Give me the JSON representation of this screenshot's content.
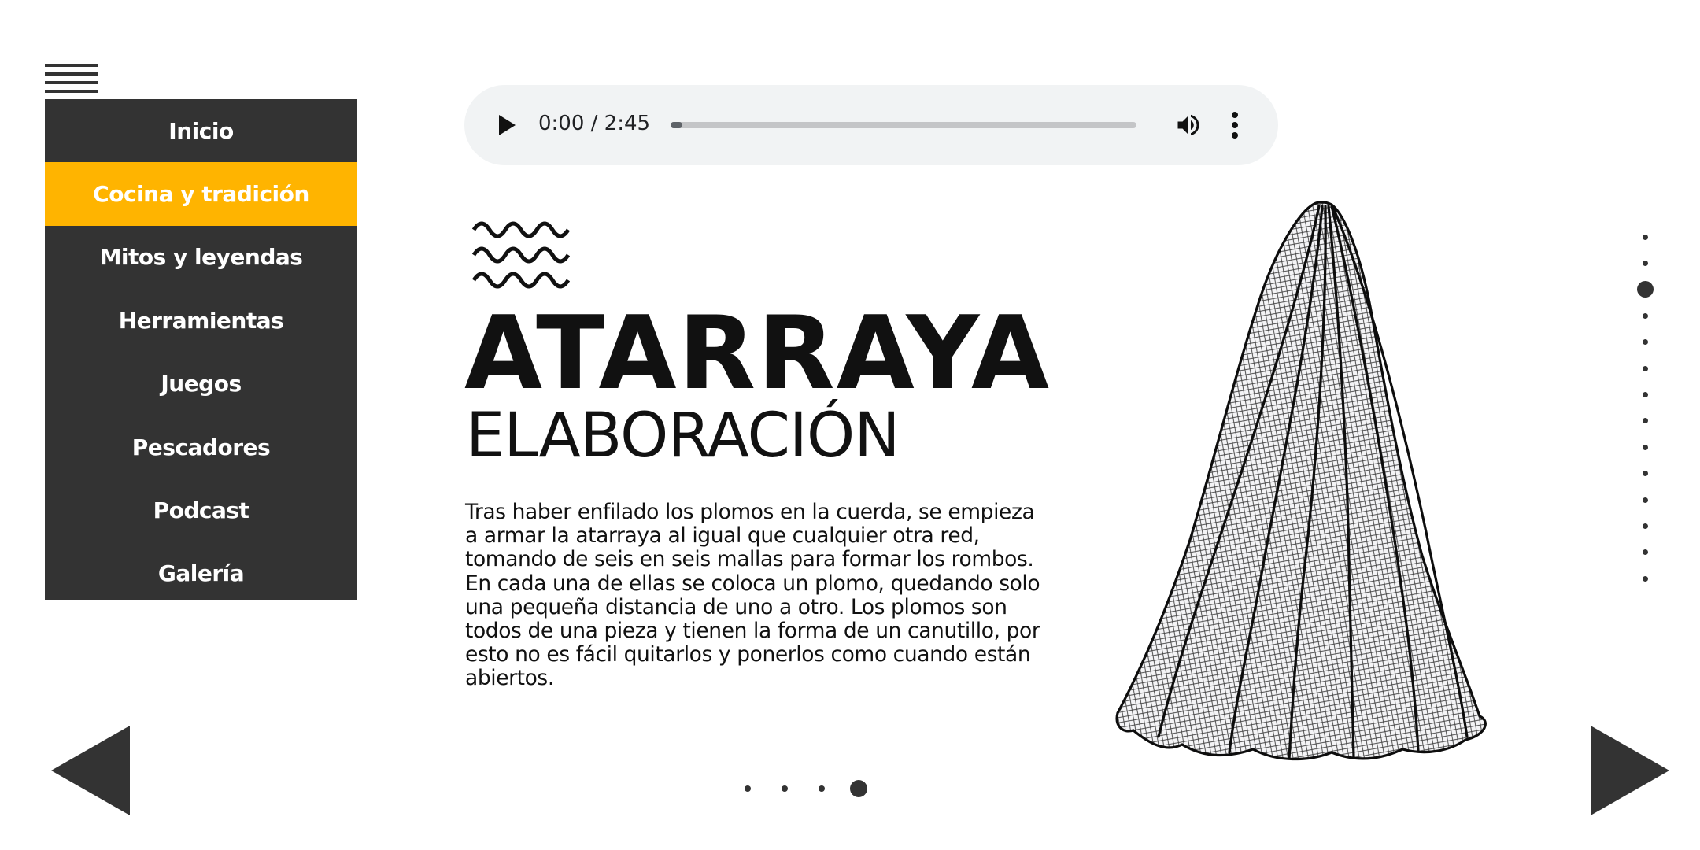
{
  "menu": {
    "icon": "hamburger-menu-icon",
    "items": [
      {
        "label": "Inicio",
        "active": false
      },
      {
        "label": "Cocina y tradición",
        "active": true
      },
      {
        "label": "Mitos y leyendas",
        "active": false
      },
      {
        "label": "Herramientas",
        "active": false
      },
      {
        "label": "Juegos",
        "active": false
      },
      {
        "label": "Pescadores",
        "active": false
      },
      {
        "label": "Podcast",
        "active": false
      },
      {
        "label": "Galería",
        "active": false
      }
    ]
  },
  "audio": {
    "time": "0:00 / 2:45",
    "progress": 0.0,
    "icons": [
      "play-icon",
      "volume-icon",
      "more-options-icon"
    ]
  },
  "content": {
    "decoration_icon": "wave-icon",
    "title": "ATARRAYA",
    "subtitle": "ELABORACIÓN",
    "paragraph": "Tras haber enfilado los plomos en la cuerda, se empieza a armar la atarraya al igual que cualquier otra red, tomando de seis en seis mallas para formar los rombos. En cada una de ellas se coloca un plomo, quedando solo una pequeña distancia de uno a otro. Los plomos son todos de una pieza y tienen la forma de un canutillo, por esto no es fácil quitarlos y ponerlos como cuando están abiertos.",
    "illustration": "cast-net-illustration"
  },
  "pagination": {
    "vertical_count": 14,
    "vertical_active_index": 2,
    "horizontal_count": 4,
    "horizontal_active_index": 3
  },
  "navigation": {
    "prev_icon": "arrow-left-icon",
    "next_icon": "arrow-right-icon"
  },
  "colors": {
    "menu_bg": "#333333",
    "menu_active": "#ffb400",
    "text": "#111111",
    "player_bg": "#f1f3f4"
  }
}
